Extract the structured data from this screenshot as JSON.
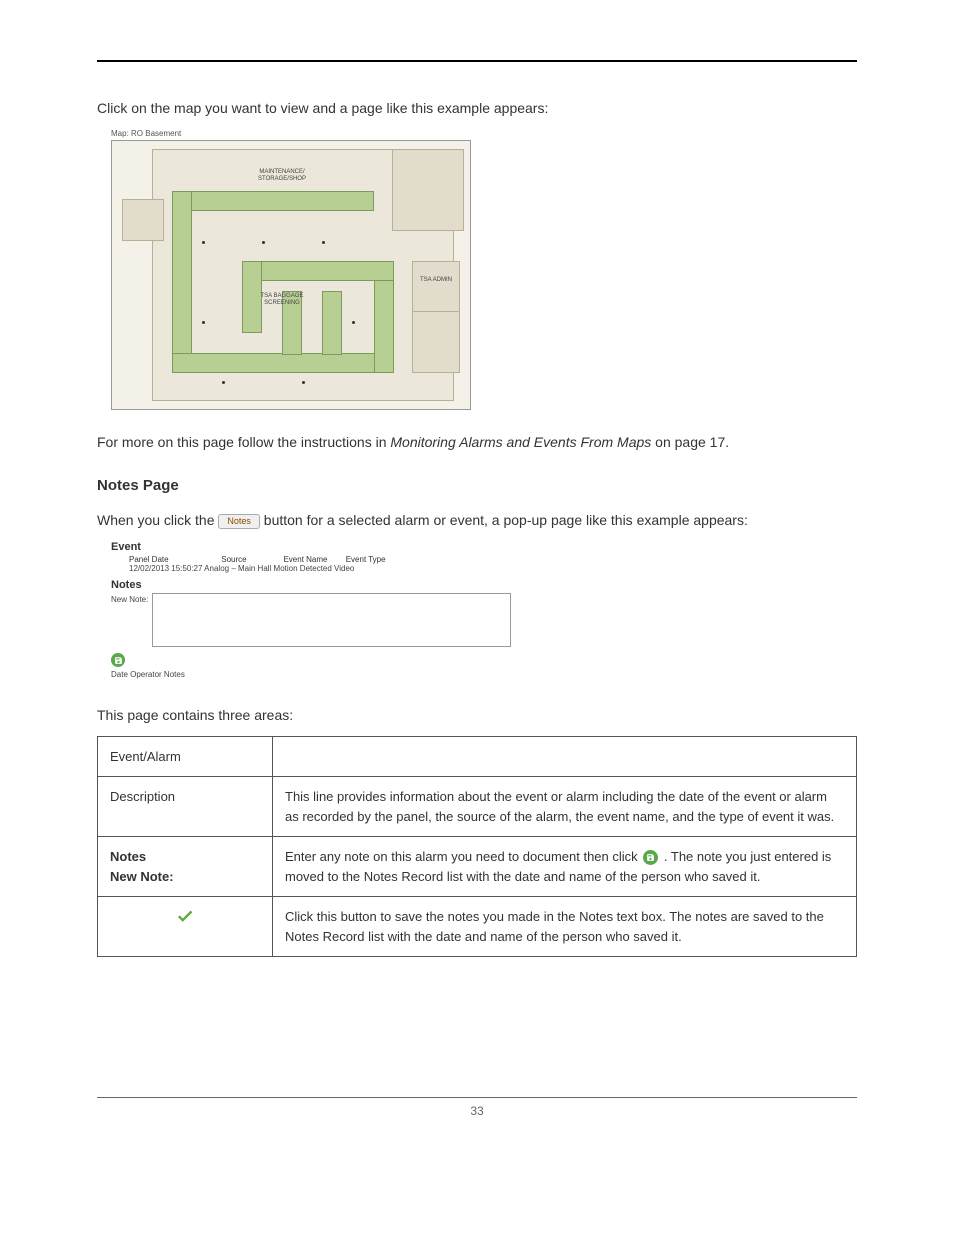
{
  "intro_text": "Click on the map you want to view and a page like this example appears:",
  "map": {
    "caption": "Map: RO Basement",
    "labels": {
      "maintenance": "MAINTENANCE/\nSTORAGE/SHOP",
      "tsa_baggage": "TSA BAGGAGE\nSCREENING",
      "tsa_admin": "TSA\nADMIN"
    }
  },
  "followup_prefix": "For more on this page follow the instructions in ",
  "followup_ref": "Monitoring Alarms and Events From Maps",
  "followup_suffix": " on page 17.",
  "notes_heading": "Notes Page",
  "notes_intro_prefix": "When you click the ",
  "notes_button_label": "Notes",
  "notes_intro_suffix": " button for a selected alarm or event, a pop-up page like this example appears:",
  "notes_figure": {
    "event_title": "Event",
    "headers": {
      "panel_date": "Panel Date",
      "source": "Source",
      "event_name": "Event Name",
      "event_type": "Event Type"
    },
    "row": "12/02/2013 15:50:27 Analog – Main Hall Motion Detected Video",
    "notes_title": "Notes",
    "new_note_label": "New Note:",
    "record_header": "Date Operator Notes"
  },
  "areas_intro": "This page contains three areas:",
  "table": {
    "r1c1": "Event/Alarm",
    "r1c2": "",
    "r2c1": "Description",
    "r2c2": "This line provides information about the event or alarm including the date of the event or alarm as recorded by the panel, the source of the alarm, the event name, and the type of event it was.",
    "r3c1a": "Notes",
    "r3c1b": "New Note:",
    "r3c2_prefix": "Enter any note on this alarm you need to document then click ",
    "r3c2_suffix": ". The note you just entered is moved to the Notes Record list with the date and name of the person who saved it.",
    "r4c2": "Click this button to save the notes you made in the Notes text box. The notes are saved to the Notes Record list with the date and name of the person who saved it."
  },
  "page_number": "33"
}
